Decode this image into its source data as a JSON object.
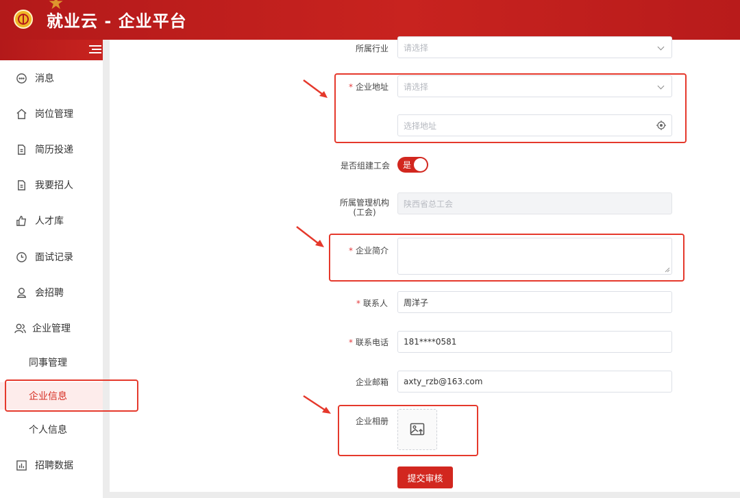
{
  "header": {
    "title": "就业云 - 企业平台"
  },
  "sidebar": {
    "items": [
      {
        "label": "消息",
        "icon": "message-icon"
      },
      {
        "label": "岗位管理",
        "icon": "home-icon"
      },
      {
        "label": "简历投递",
        "icon": "document-icon"
      },
      {
        "label": "我要招人",
        "icon": "document-icon"
      },
      {
        "label": "人才库",
        "icon": "thumbs-up-icon"
      },
      {
        "label": "面试记录",
        "icon": "clock-icon"
      },
      {
        "label": "会招聘",
        "icon": "person-badge-icon"
      },
      {
        "label": "企业管理",
        "icon": "people-icon"
      }
    ],
    "sub_items": [
      "同事管理",
      "企业信息",
      "个人信息"
    ],
    "active_sub": "企业信息",
    "bottom_item": {
      "label": "招聘数据",
      "icon": "bar-chart-icon"
    }
  },
  "form": {
    "industry": {
      "label": "所属行业",
      "placeholder": "请选择"
    },
    "address": {
      "label": "企业地址",
      "placeholder": "请选择",
      "detail_placeholder": "选择地址"
    },
    "union": {
      "label": "是否组建工会",
      "value": "是"
    },
    "org": {
      "label_line1": "所属管理机构",
      "label_line2": "(工会)",
      "value": "陕西省总工会"
    },
    "intro": {
      "label": "企业简介",
      "value": ""
    },
    "contact": {
      "label": "联系人",
      "value": "周洋子"
    },
    "phone": {
      "label": "联系电话",
      "value": "181****0581"
    },
    "email": {
      "label": "企业邮箱",
      "value": "axty_rzb@163.com"
    },
    "album": {
      "label": "企业相册"
    },
    "submit_label": "提交审核"
  },
  "colors": {
    "brand_red": "#d2271f",
    "annotation_red": "#e5382b",
    "active_bg": "#fdeceb"
  }
}
